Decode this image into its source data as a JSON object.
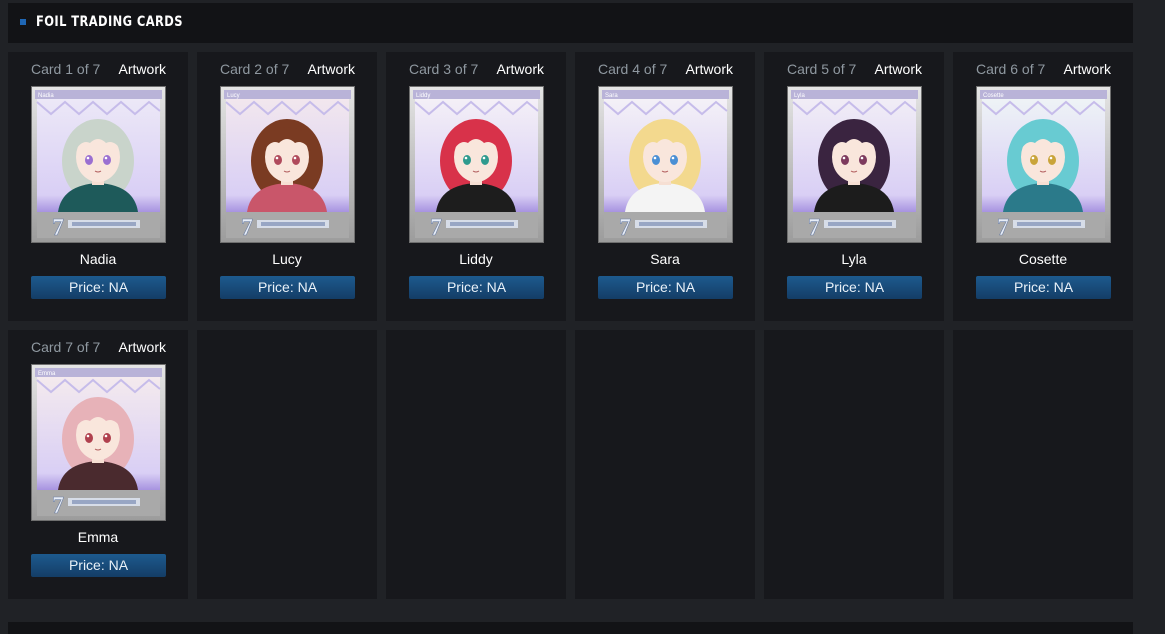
{
  "section": {
    "title": "FOIL TRADING CARDS"
  },
  "artwork_label": "Artwork",
  "price_label": "Price: NA",
  "cards": [
    {
      "count": "Card 1 of 7",
      "name": "Nadia",
      "tag": "Nadia",
      "hair": "#c9d4cb",
      "outfit": "#1e5a5a",
      "eyes": "#9a6fd1",
      "bg": "#ece8f7"
    },
    {
      "count": "Card 2 of 7",
      "name": "Lucy",
      "tag": "Lucy",
      "hair": "#7a3b22",
      "outfit": "#c9566a",
      "eyes": "#b04a5c",
      "bg": "#f2e7ee"
    },
    {
      "count": "Card 3 of 7",
      "name": "Liddy",
      "tag": "Liddy",
      "hair": "#d8324a",
      "outfit": "#1d1d1d",
      "eyes": "#2f9a8e",
      "bg": "#f4f0f7"
    },
    {
      "count": "Card 4 of 7",
      "name": "Sara",
      "tag": "Sara",
      "hair": "#f3d98e",
      "outfit": "#f4f4f4",
      "eyes": "#4a8fd4",
      "bg": "#f4f1f7"
    },
    {
      "count": "Card 5 of 7",
      "name": "Lyla",
      "tag": "Lyla",
      "hair": "#3a2440",
      "outfit": "#1c1c1c",
      "eyes": "#7d3a5e",
      "bg": "#f1edf6"
    },
    {
      "count": "Card 6 of 7",
      "name": "Cosette",
      "tag": "Cosette",
      "hair": "#68cbd2",
      "outfit": "#2b7a8a",
      "eyes": "#c9a43a",
      "bg": "#eef3f6"
    },
    {
      "count": "Card 7 of 7",
      "name": "Emma",
      "tag": "Emma",
      "hair": "#e7b2b8",
      "outfit": "#4a2a2e",
      "eyes": "#b0404e",
      "bg": "#f4eaee"
    }
  ],
  "colors": {
    "page_bg": "#202226",
    "cell_bg": "#17181c",
    "accent": "#1f67b5",
    "price_button": "#1a4c7a"
  },
  "icons": {
    "section_bullet": "square-bullet-icon",
    "card_logo": "7-girls-war-logo"
  }
}
